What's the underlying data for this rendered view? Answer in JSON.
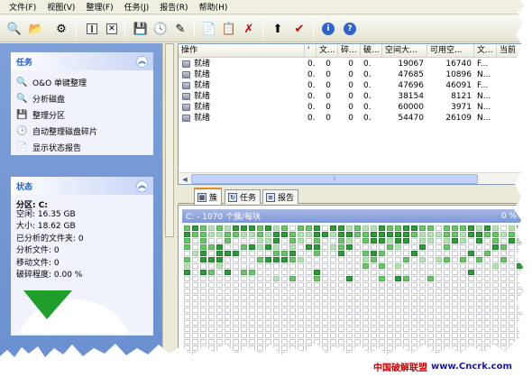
{
  "menu": [
    "文件(F)",
    "视图(V)",
    "整理(F)",
    "任务(J)",
    "报告(R)",
    "帮助(H)"
  ],
  "toolbar_icons": [
    "search-icon",
    "open-icon",
    "settings-icon",
    "pause-icon",
    "stop-icon",
    "defrag-icon",
    "schedule-icon",
    "wizard-icon",
    "new-icon",
    "copy-icon",
    "delete-icon",
    "priority-icon",
    "report-icon",
    "info-icon",
    "help-icon"
  ],
  "tasks_panel": {
    "title": "任务",
    "items": [
      "O&O 单键整理",
      "分析磁盘",
      "整理分区",
      "自动整理磁盘碎片",
      "显示状态报告"
    ]
  },
  "status_panel": {
    "title": "状态",
    "partition": "分区: C:",
    "lines": [
      "空闲: 16.35 GB",
      "大小: 18.62 GB",
      "已分析的文件夹: 0",
      "分析文件: 0",
      "移动文件: 0",
      "破碎程度: 0.00 %"
    ]
  },
  "list": {
    "columns": [
      "操作",
      "'",
      "文...",
      "碎...",
      "破...",
      "空间大...",
      "可用空...",
      "文...",
      "当前"
    ],
    "rows": [
      {
        "op": "就绪",
        "c1": "0.",
        "c2": "0",
        "c3": "0",
        "c4": "0.",
        "size": "19067",
        "free": "16740",
        "fs": "F..."
      },
      {
        "op": "就绪",
        "c1": "0.",
        "c2": "0",
        "c3": "0",
        "c4": "0.",
        "size": "47685",
        "free": "10896",
        "fs": "N..."
      },
      {
        "op": "就绪",
        "c1": "0.",
        "c2": "0",
        "c3": "0",
        "c4": "0.",
        "size": "47696",
        "free": "46091",
        "fs": "F..."
      },
      {
        "op": "就绪",
        "c1": "0.",
        "c2": "0",
        "c3": "0",
        "c4": "0.",
        "size": "38154",
        "free": "8121",
        "fs": "N..."
      },
      {
        "op": "就绪",
        "c1": "0.",
        "c2": "0",
        "c3": "0",
        "c4": "0.",
        "size": "60000",
        "free": "3971",
        "fs": "N..."
      },
      {
        "op": "就绪",
        "c1": "0.",
        "c2": "0",
        "c3": "0",
        "c4": "0.",
        "size": "54470",
        "free": "26109",
        "fs": "N..."
      }
    ]
  },
  "tabs": [
    "簇",
    "任务",
    "报告"
  ],
  "cluster_map": {
    "title": "C: - 1070 个簇/每块",
    "percent": "0 %"
  },
  "watermark": {
    "cn": "中国破解联盟",
    "url": "www.Cncrk.com"
  }
}
